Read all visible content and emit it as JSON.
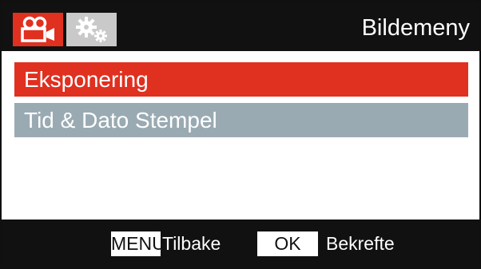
{
  "header": {
    "title": "Bildemeny",
    "tabs": [
      {
        "icon": "video-camera-icon",
        "active": true
      },
      {
        "icon": "settings-gears-icon",
        "active": false
      }
    ]
  },
  "menu": {
    "items": [
      {
        "label": "Eksponering",
        "selected": true
      },
      {
        "label": "Tid & Dato Stempel",
        "selected": false
      }
    ]
  },
  "footer": {
    "menu_key": "MENU",
    "menu_action": "Tilbake",
    "ok_key": "OK",
    "ok_action": "Bekrefte"
  },
  "colors": {
    "accent": "#e03020",
    "secondary": "#9aaab3",
    "bar": "#111111"
  }
}
